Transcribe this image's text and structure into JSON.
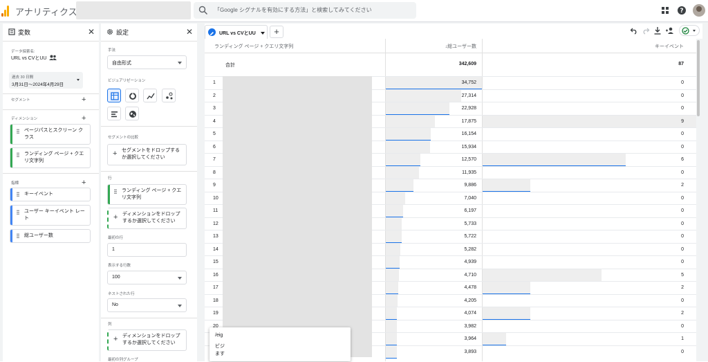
{
  "app": {
    "name": "アナリティクス"
  },
  "search": {
    "placeholder": "「Google シグナルを有効にする方法」と検索してみてください"
  },
  "colors": {
    "accent": "#1a73e8",
    "dimension": "#34a853",
    "metric": "#4285f4",
    "logo_orange": "#f9ab00",
    "logo_dark": "#e37400"
  },
  "variables": {
    "title": "変数",
    "exploration_label": "データ探索名:",
    "exploration_name": "URL vs CVとUU",
    "date_label": "過去 30 日間",
    "date_range": "3月31日～2024年4月29日",
    "segments_label": "セグメント",
    "dimensions_label": "ディメンション",
    "dimensions": [
      "ページパスとスクリーン クラス",
      "ランディング ページ + クエリ文字列"
    ],
    "metrics_label": "指標",
    "metrics": [
      "キーイベント",
      "ユーザー キーイベント レート",
      "総ユーザー数"
    ]
  },
  "settings": {
    "title": "設定",
    "technique_label": "手法",
    "technique": "自由形式",
    "viz_label": "ビジュアリゼーション",
    "viz_icons": [
      "table-icon",
      "donut-icon",
      "line-icon",
      "scatter-icon",
      "bar-icon",
      "geo-icon"
    ],
    "segment_compare_label": "セグメントの比較",
    "segment_drop": "セグメントをドロップするか選択してください",
    "rows_label": "行",
    "row_dimension": "ランディング ページ + クエリ文字列",
    "row_drop": "ディメンションをドロップするか選択してください",
    "start_row_label": "最初の行",
    "start_row": "1",
    "show_rows_label": "表示する行数",
    "show_rows": "100",
    "nested_label": "ネストされた行",
    "nested": "No",
    "columns_label": "列",
    "column_drop": "ディメンションをドロップするか選択してください",
    "first_col_group_label": "最初の列グループ"
  },
  "tab": {
    "label": "URL vs CVとUU",
    "add": "+"
  },
  "table": {
    "col_dimension": "ランディング ページ + クエリ文字列",
    "col_users": "↓総ユーザー数",
    "col_events": "キーイベント",
    "total_label": "合計",
    "total_users": "342,609",
    "total_events": "87",
    "rows": [
      {
        "n": "1",
        "users": "34,752",
        "events": "0",
        "u": 34752,
        "e": 0
      },
      {
        "n": "2",
        "users": "27,314",
        "events": "0",
        "u": 27314,
        "e": 0
      },
      {
        "n": "3",
        "users": "22,928",
        "events": "0",
        "u": 22928,
        "e": 0
      },
      {
        "n": "4",
        "users": "17,875",
        "events": "9",
        "u": 17875,
        "e": 9
      },
      {
        "n": "5",
        "users": "16,154",
        "events": "0",
        "u": 16154,
        "e": 0
      },
      {
        "n": "6",
        "users": "15,934",
        "events": "0",
        "u": 15934,
        "e": 0
      },
      {
        "n": "7",
        "users": "12,570",
        "events": "6",
        "u": 12570,
        "e": 6
      },
      {
        "n": "8",
        "users": "11,935",
        "events": "0",
        "u": 11935,
        "e": 0
      },
      {
        "n": "9",
        "users": "9,886",
        "events": "2",
        "u": 9886,
        "e": 2
      },
      {
        "n": "10",
        "users": "7,040",
        "events": "0",
        "u": 7040,
        "e": 0
      },
      {
        "n": "11",
        "users": "6,197",
        "events": "0",
        "u": 6197,
        "e": 0
      },
      {
        "n": "12",
        "users": "5,733",
        "events": "0",
        "u": 5733,
        "e": 0
      },
      {
        "n": "13",
        "users": "5,722",
        "events": "0",
        "u": 5722,
        "e": 0
      },
      {
        "n": "14",
        "users": "5,282",
        "events": "0",
        "u": 5282,
        "e": 0
      },
      {
        "n": "15",
        "users": "4,939",
        "events": "0",
        "u": 4939,
        "e": 0
      },
      {
        "n": "16",
        "users": "4,710",
        "events": "5",
        "u": 4710,
        "e": 5
      },
      {
        "n": "17",
        "users": "4,478",
        "events": "2",
        "u": 4478,
        "e": 2
      },
      {
        "n": "18",
        "users": "4,205",
        "events": "0",
        "u": 4205,
        "e": 0
      },
      {
        "n": "19",
        "users": "4,074",
        "events": "2",
        "u": 4074,
        "e": 2
      },
      {
        "n": "20",
        "users": "3,982",
        "events": "0",
        "u": 3982,
        "e": 0
      },
      {
        "n": "21",
        "users": "3,964",
        "events": "1",
        "u": 3964,
        "e": 1
      },
      {
        "n": "22",
        "users": "3,893",
        "events": "0",
        "u": 3893,
        "e": 0
      }
    ]
  },
  "tooltip": {
    "line1": "/eig",
    "line2": "ビジ",
    "line3": "ます"
  }
}
